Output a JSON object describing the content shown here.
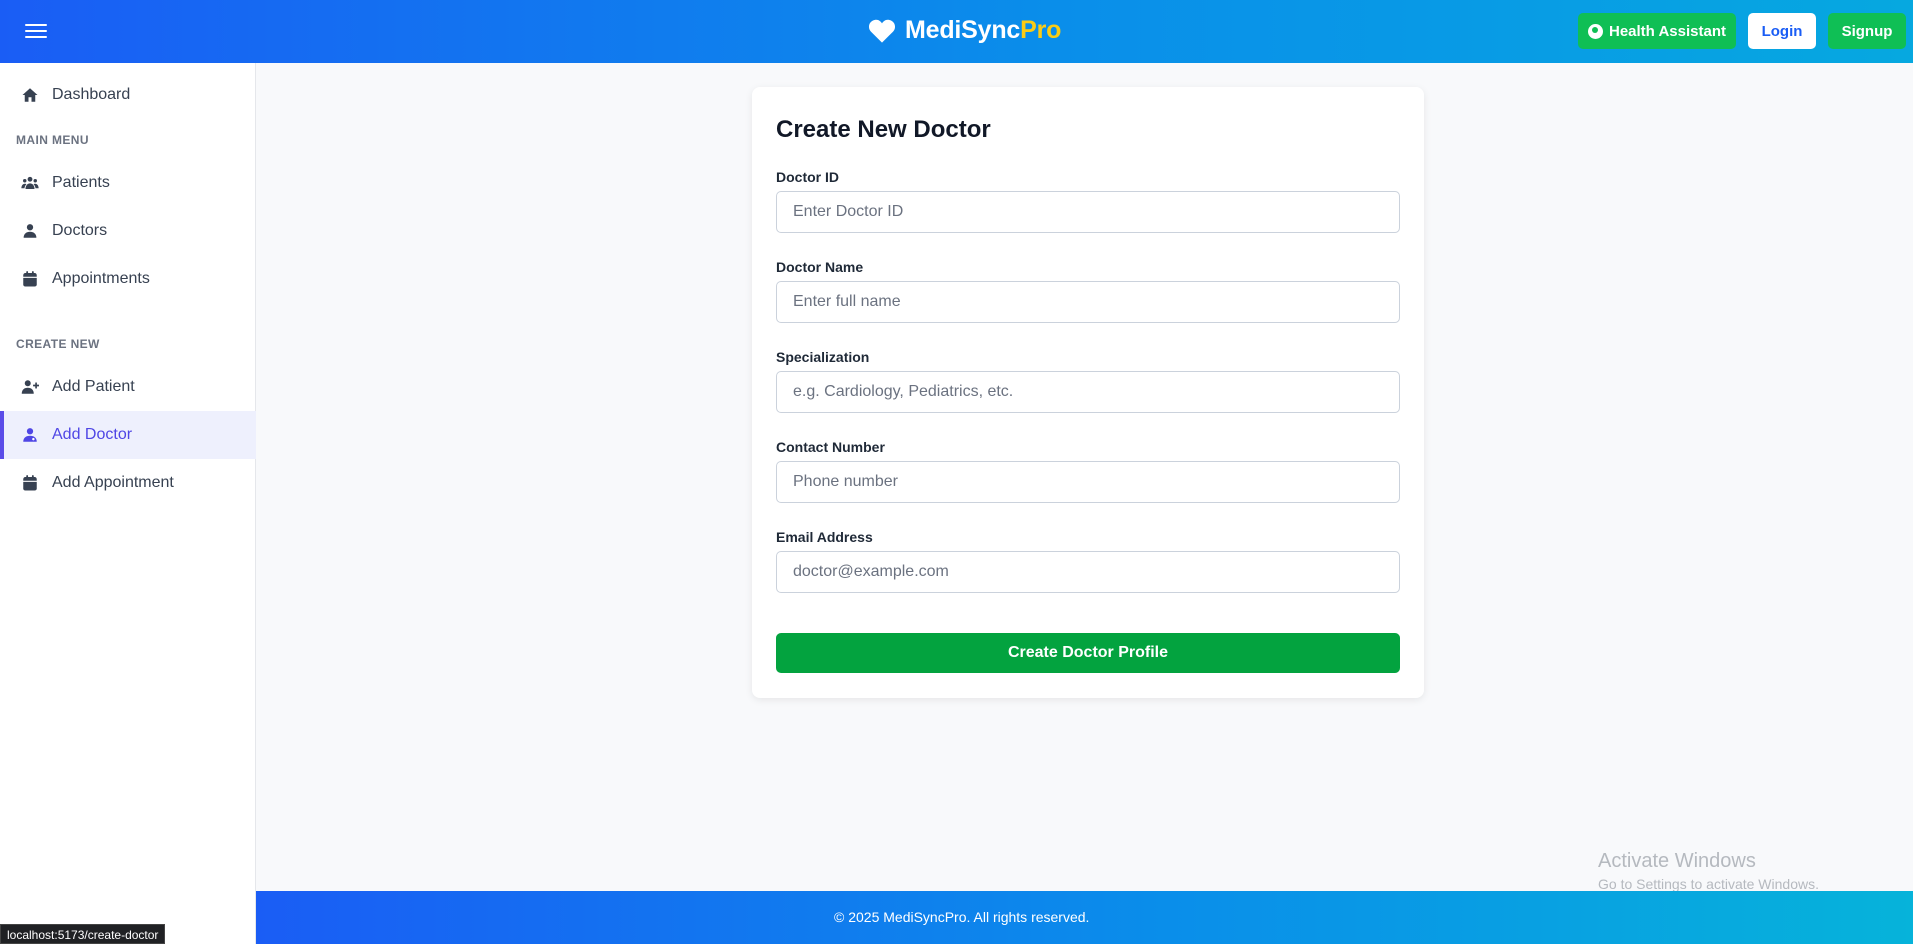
{
  "header": {
    "brand_main": "MediSync",
    "brand_accent": "Pro",
    "assistant_label": "Health Assistant",
    "login_label": "Login",
    "signup_label": "Signup"
  },
  "sidebar": {
    "dashboard": "Dashboard",
    "main_menu_title": "MAIN MENU",
    "main_items": [
      "Patients",
      "Doctors",
      "Appointments"
    ],
    "create_title": "CREATE NEW",
    "create_items": [
      "Add Patient",
      "Add Doctor",
      "Add Appointment"
    ],
    "active_item": "Add Doctor"
  },
  "form": {
    "title": "Create New Doctor",
    "fields": [
      {
        "label": "Doctor ID",
        "placeholder": "Enter Doctor ID",
        "value": ""
      },
      {
        "label": "Doctor Name",
        "placeholder": "Enter full name",
        "value": ""
      },
      {
        "label": "Specialization",
        "placeholder": "e.g. Cardiology, Pediatrics, etc.",
        "value": ""
      },
      {
        "label": "Contact Number",
        "placeholder": "Phone number",
        "value": ""
      },
      {
        "label": "Email Address",
        "placeholder": "doctor@example.com",
        "value": ""
      }
    ],
    "submit_label": "Create Doctor Profile"
  },
  "footer": {
    "text": "© 2025 MediSyncPro. All rights reserved."
  },
  "watermark": {
    "title": "Activate Windows",
    "subtitle": "Go to Settings to activate Windows."
  },
  "status_url": "localhost:5173/create-doctor",
  "colors": {
    "primary": "#1a5df5",
    "success": "#0fbf55",
    "submit": "#03a33f",
    "active": "#4f46e5",
    "brand_accent": "#facc15"
  }
}
